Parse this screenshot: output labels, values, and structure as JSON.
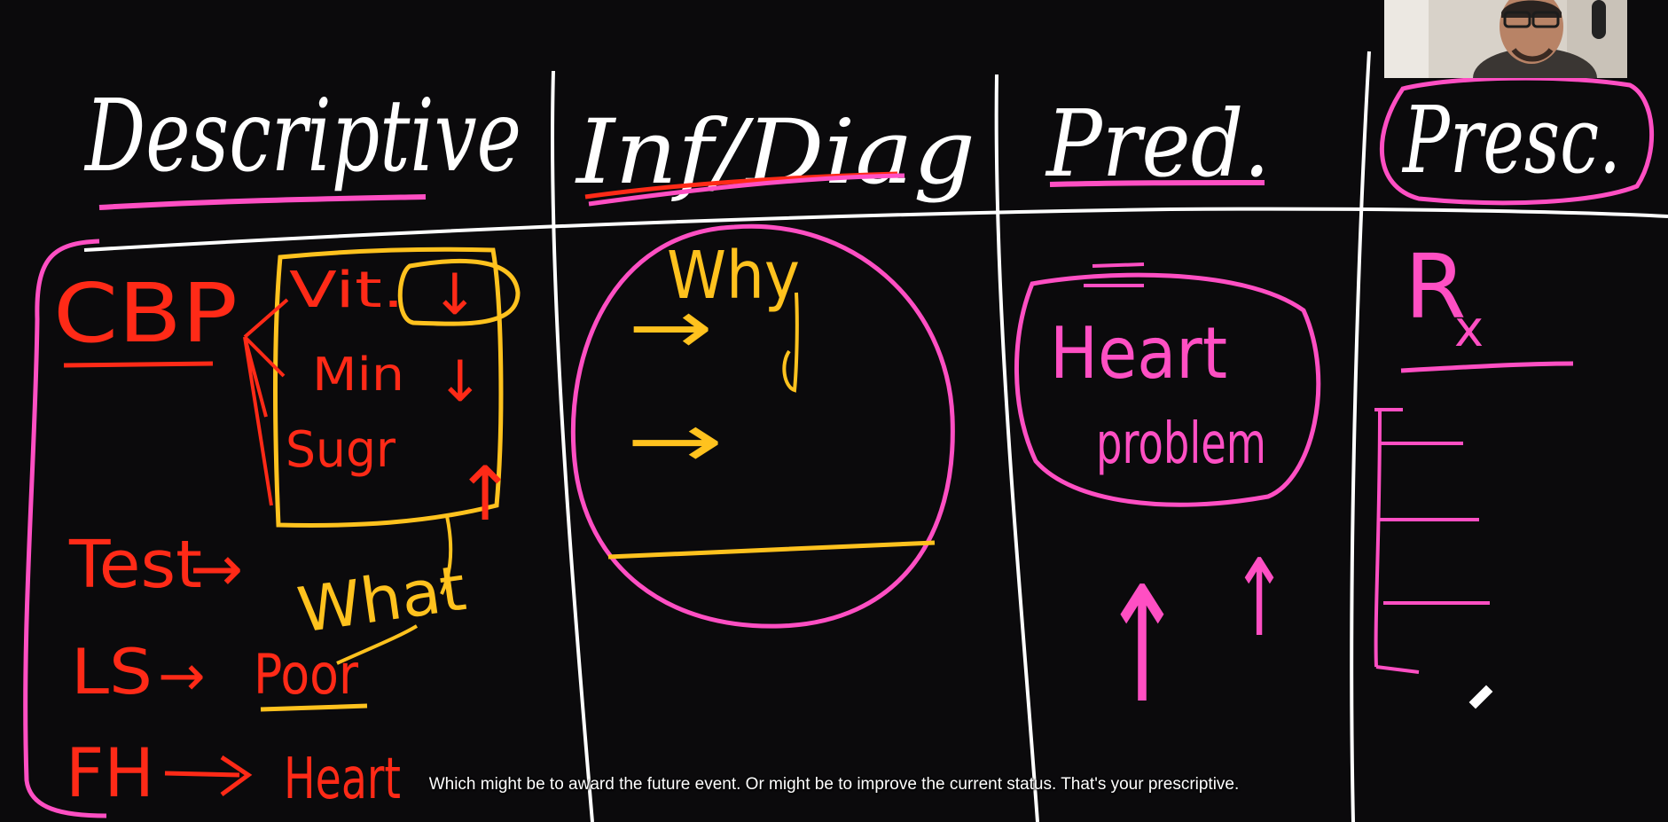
{
  "whiteboard": {
    "columns": [
      {
        "heading": "Descriptive"
      },
      {
        "heading": "Inf/Diag"
      },
      {
        "heading": "Pred."
      },
      {
        "heading": "Presc."
      }
    ],
    "descriptive": {
      "cbp": "CBP",
      "vit": "Vit.",
      "min": "Min",
      "sugar": "Sugr",
      "test": "Test",
      "ls": "LS",
      "poor": "Poor",
      "fh": "FH",
      "heart": "Heart",
      "what": "What",
      "arrow": "→",
      "down_arrow": "↓",
      "up_arrow": "↑"
    },
    "diagnostic": {
      "why": "Why",
      "arrow": "→"
    },
    "predictive": {
      "heart": "Heart",
      "problem": "problem",
      "up_arrow": "↑"
    },
    "prescriptive": {
      "rx": "R",
      "rx_sub": "x"
    }
  },
  "colors": {
    "background": "#0b0a0c",
    "chalk_white": "#ffffff",
    "pink": "#ff4fc3",
    "red": "#ff2a17",
    "yellow": "#ffc21e"
  },
  "caption": {
    "text": "Which might be to award the future event. Or might be to improve the current status. That's your prescriptive."
  }
}
